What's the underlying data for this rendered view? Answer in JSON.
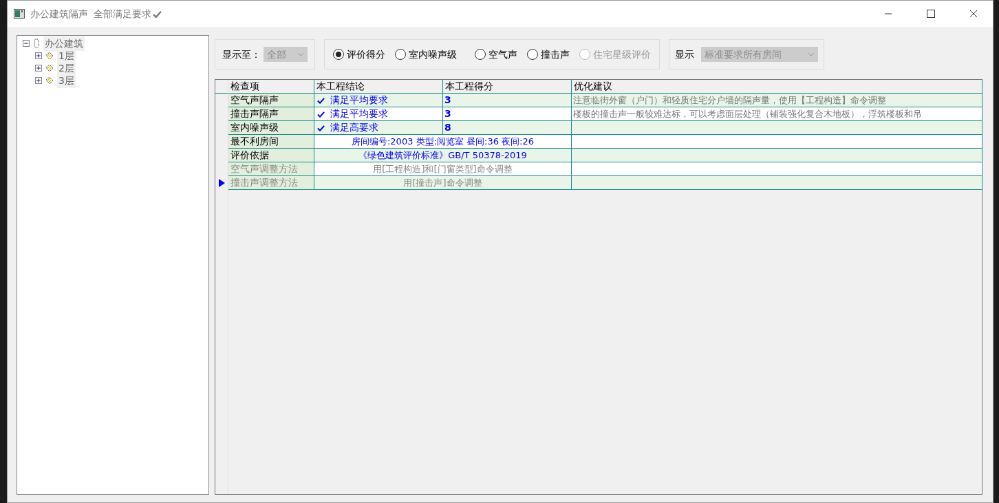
{
  "window": {
    "title": "办公建筑隔声",
    "status": "全部满足要求",
    "status_ok": true
  },
  "tree": {
    "label": "办公建筑",
    "expanded": true,
    "children": [
      {
        "label": "1层",
        "expanded": false
      },
      {
        "label": "2层",
        "expanded": false
      },
      {
        "label": "3层",
        "expanded": false
      }
    ]
  },
  "level_filter": {
    "label": "显示至：",
    "value": "全部",
    "disabled": true
  },
  "modes": [
    {
      "label": "评价得分",
      "selected": true,
      "disabled": false
    },
    {
      "label": "室内噪声级",
      "selected": false,
      "disabled": false
    },
    {
      "label": "空气声",
      "selected": false,
      "disabled": false
    },
    {
      "label": "撞击声",
      "selected": false,
      "disabled": false
    },
    {
      "label": "住宅星级评价",
      "selected": false,
      "disabled": true
    }
  ],
  "room_filter": {
    "label": "显示",
    "value": "标准要求所有房间",
    "disabled": true
  },
  "table": {
    "columns": [
      "检查项",
      "本工程结论",
      "本工程得分",
      "优化建议"
    ],
    "rows": [
      {
        "kind": "result",
        "item": "空气声隔声",
        "conclusion": "满足平均要求",
        "met": true,
        "score": "3",
        "advice": "注意临街外窗（户门）和轻质住宅分户墙的隔声量，使用【工程构造】命令调整",
        "dim": false,
        "current": false
      },
      {
        "kind": "result",
        "item": "撞击声隔声",
        "conclusion": "满足平均要求",
        "met": true,
        "score": "3",
        "advice": "楼板的撞击声一般较难达标，可以考虑面层处理（铺装强化复合木地板），浮筑楼板和吊",
        "dim": false,
        "current": false
      },
      {
        "kind": "result",
        "item": "室内噪声级",
        "conclusion": "满足高要求",
        "met": true,
        "score": "8",
        "dim": false,
        "current": false
      },
      {
        "kind": "info",
        "item": "最不利房间",
        "text": "房间编号:2003 类型:阅览室 昼间:36 夜间:26",
        "dim": false,
        "current": false
      },
      {
        "kind": "info",
        "item": "评价依据",
        "text": "《绿色建筑评价标准》GB/T 50378-2019",
        "dim": false,
        "current": false
      },
      {
        "kind": "info",
        "item": "空气声调整方法",
        "text": "用[工程构造]和[门窗类型]命令调整",
        "dim": true,
        "current": false
      },
      {
        "kind": "info",
        "item": "撞击声调整方法",
        "text": "用[撞击声]命令调整",
        "dim": true,
        "current": true
      }
    ]
  }
}
